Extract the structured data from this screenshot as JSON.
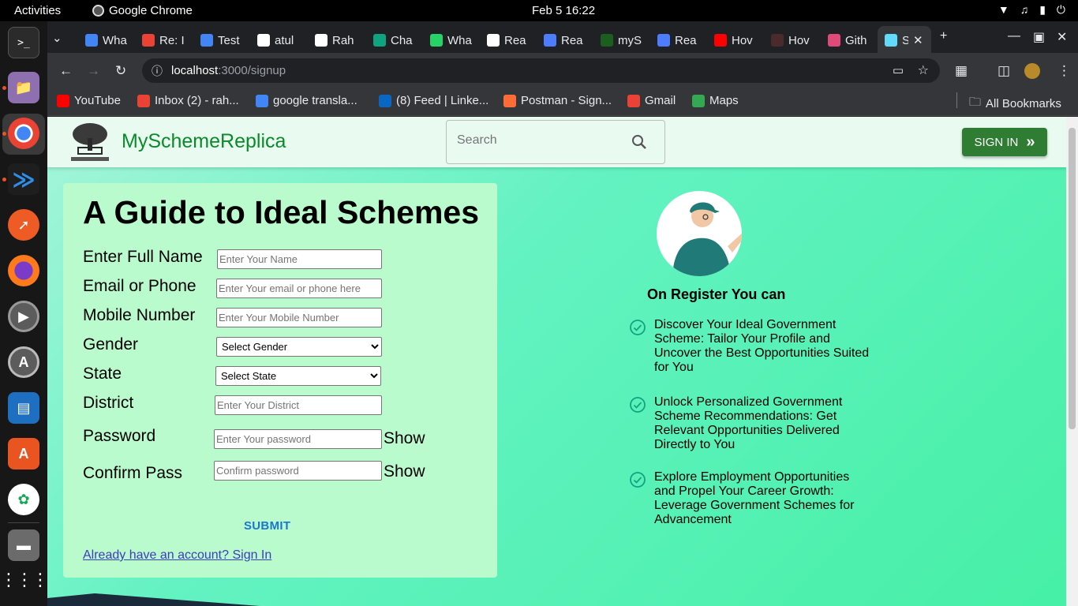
{
  "system": {
    "activities": "Activities",
    "app_name": "Google Chrome",
    "clock": "Feb 5  16:22"
  },
  "browser": {
    "tabs": [
      {
        "label": "Wha",
        "color": "#4285f4"
      },
      {
        "label": "Re: I",
        "color": "#ea4335"
      },
      {
        "label": "Test",
        "color": "#4285f4"
      },
      {
        "label": "atul",
        "color": "#ffffff"
      },
      {
        "label": "Rah",
        "color": "#ffffff"
      },
      {
        "label": "Cha",
        "color": "#10a37f"
      },
      {
        "label": "Wha",
        "color": "#25d366"
      },
      {
        "label": "Rea",
        "color": "#ffffff"
      },
      {
        "label": "Rea",
        "color": "#4c7dff"
      },
      {
        "label": "myS",
        "color": "#1b5e20"
      },
      {
        "label": "Rea",
        "color": "#4c7dff"
      },
      {
        "label": "Hov",
        "color": "#ff0000"
      },
      {
        "label": "Hov",
        "color": "#4a2a2a"
      },
      {
        "label": "Gith",
        "color": "#e04a7a"
      },
      {
        "label": "S",
        "color": "#61dafb"
      }
    ],
    "url_host": "localhost",
    "url_path": ":3000/signup",
    "bookmarks": [
      {
        "label": "YouTube",
        "color": "#ff0000"
      },
      {
        "label": "Inbox (2) - rah...",
        "color": "#ea4335"
      },
      {
        "label": "google transla...",
        "color": "#4285f4"
      },
      {
        "label": "(8) Feed | Linke...",
        "color": "#0a66c2"
      },
      {
        "label": "Postman - Sign...",
        "color": "#ff6c37"
      },
      {
        "label": "Gmail",
        "color": "#ea4335"
      },
      {
        "label": "Maps",
        "color": "#34a853"
      }
    ],
    "all_bookmarks": "All Bookmarks"
  },
  "site": {
    "brand": "MySchemeReplica",
    "search_placeholder": "Search",
    "signin_label": "SIGN IN"
  },
  "form": {
    "title": "A Guide to Ideal Schemes",
    "full_name_label": "Enter Full Name",
    "full_name_placeholder": "Enter Your Name",
    "email_label": "Email or Phone",
    "email_placeholder": "Enter Your email or phone here",
    "mobile_label": "Mobile Number",
    "mobile_placeholder": "Enter Your Mobile Number",
    "gender_label": "Gender",
    "gender_selected": "Select Gender",
    "state_label": "State",
    "state_selected": "Select State",
    "district_label": "District",
    "district_placeholder": "Enter Your District",
    "password_label": "Password",
    "password_placeholder": "Enter Your password",
    "confirm_label": "Confirm Pass",
    "confirm_placeholder": "Confirm password",
    "show_label": "Show",
    "submit_label": "SUBMIT",
    "already_link": "Already have an account? Sign In"
  },
  "benefits": {
    "heading": "On Register You can",
    "items": [
      "Discover Your Ideal Government Scheme: Tailor Your Profile and Uncover the Best Opportunities Suited for You",
      "Unlock Personalized Government Scheme Recommendations: Get Relevant Opportunities Delivered Directly to You",
      "Explore Employment Opportunities and Propel Your Career Growth: Leverage Government Schemes for Advancement"
    ],
    "check_color": "#14a37f"
  },
  "colors": {
    "brand_green": "#0b8a2a",
    "signin_bg": "#2e7d32",
    "card_bg": "#b9fbcc",
    "submit_blue": "#1976d2"
  }
}
